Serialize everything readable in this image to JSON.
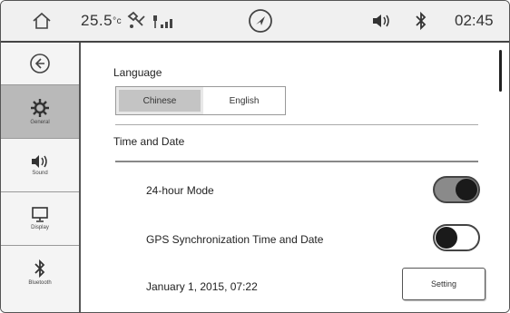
{
  "status": {
    "temperature": "25.5",
    "temp_unit": "°c",
    "clock": "02:45"
  },
  "sidebar": {
    "items": [
      {
        "label": "General",
        "icon": "gear-icon",
        "active": true
      },
      {
        "label": "Sound",
        "icon": "speaker-icon",
        "active": false
      },
      {
        "label": "Display",
        "icon": "monitor-icon",
        "active": false
      },
      {
        "label": "Bluetooth",
        "icon": "bluetooth-icon",
        "active": false
      }
    ]
  },
  "main": {
    "language_label": "Language",
    "language_options": [
      "Chinese",
      "English"
    ],
    "language_selected": "Chinese",
    "time_section_label": "Time and Date",
    "hour24_label": "24-hour Mode",
    "hour24_on": true,
    "gps_sync_label": "GPS Synchronization Time and Date",
    "gps_sync_on": false,
    "current_datetime": "January 1, 2015, 07:22",
    "setting_button": "Setting"
  },
  "colors": {
    "selected_segment": "#c4c4c4",
    "active_sidebar": "#b9b9b9",
    "toggle_on": "#8a8a8a"
  }
}
